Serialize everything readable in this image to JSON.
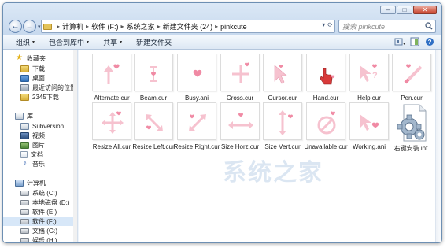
{
  "window": {
    "controls": {
      "minimize": "–",
      "maximize": "□",
      "close": "✕"
    }
  },
  "nav": {
    "back_icon": "←",
    "forward_icon": "→",
    "dropdown": "▾"
  },
  "address": {
    "crumbs": [
      "计算机",
      "软件 (F:)",
      "系统之家",
      "新建文件夹 (24)",
      "pinkcute"
    ],
    "separator": "▸",
    "refresh_icon": "⟳",
    "dropdown_icon": "▾"
  },
  "search": {
    "placeholder": "搜索 pinkcute"
  },
  "toolbar": {
    "organize": "组织",
    "include_library": "包含到库中",
    "share": "共享",
    "new_folder": "新建文件夹",
    "arrow": "▾"
  },
  "sidebar": {
    "favorites": "收藏夹",
    "downloads": "下载",
    "desktop": "桌面",
    "recent": "最近访问的位置",
    "downloads2345": "2345下载",
    "library": "库",
    "subversion": "Subversion",
    "video": "视频",
    "pictures": "图片",
    "documents": "文档",
    "music": "音乐",
    "computer": "计算机",
    "drive_c": "系统 (C:)",
    "drive_d": "本地磁盘 (D:)",
    "drive_e": "软件 (E:)",
    "drive_f": "软件 (F:)",
    "drive_g": "文档 (G:)",
    "drive_h": "娱乐 (H:)"
  },
  "files": [
    {
      "name": "Alternate.cur",
      "glyph": "alternate-cursor-icon"
    },
    {
      "name": "Beam.cur",
      "glyph": "beam-cursor-icon"
    },
    {
      "name": "Busy.ani",
      "glyph": "busy-cursor-icon"
    },
    {
      "name": "Cross.cur",
      "glyph": "cross-cursor-icon"
    },
    {
      "name": "Cursor.cur",
      "glyph": "arrow-cursor-icon"
    },
    {
      "name": "Hand.cur",
      "glyph": "hand-cursor-icon"
    },
    {
      "name": "Help.cur",
      "glyph": "help-cursor-icon"
    },
    {
      "name": "Pen.cur",
      "glyph": "pen-cursor-icon"
    },
    {
      "name": "Resize All.cur",
      "glyph": "resize-all-cursor-icon"
    },
    {
      "name": "Resize Left.cur",
      "glyph": "resize-left-cursor-icon"
    },
    {
      "name": "Resize Right.cur",
      "glyph": "resize-right-cursor-icon"
    },
    {
      "name": "Size Horz.cur",
      "glyph": "size-horz-cursor-icon"
    },
    {
      "name": "Size Vert.cur",
      "glyph": "size-vert-cursor-icon"
    },
    {
      "name": "Unavailable.cur",
      "glyph": "unavailable-cursor-icon"
    },
    {
      "name": "Working.ani",
      "glyph": "working-cursor-icon"
    },
    {
      "name": "右键安装.inf",
      "glyph": "gear-file-icon"
    }
  ],
  "watermark": "系统之家",
  "colors": {
    "pink": "#f08aa4",
    "pink_light": "#f6c2cf",
    "hand_red": "#d83a3a"
  }
}
